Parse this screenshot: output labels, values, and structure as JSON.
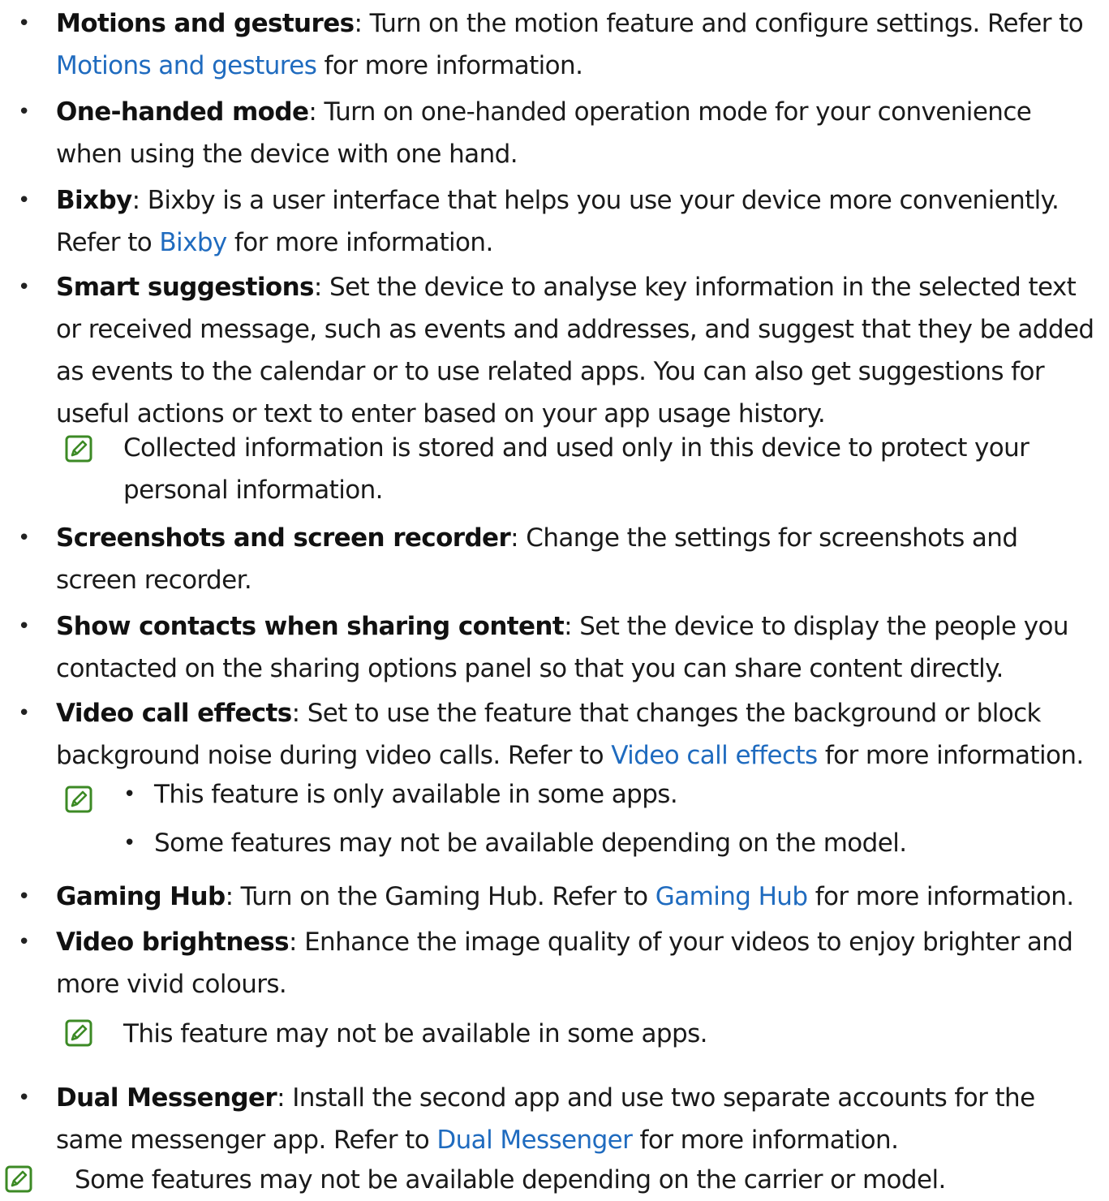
{
  "colors": {
    "text": "#1a1a1a",
    "link": "#1f6bbf",
    "note_icon": "#3c8a25"
  },
  "bullet_glyph": "•",
  "items": [
    {
      "term": "Motions and gestures",
      "before_link": ": Turn on the motion feature and configure settings. Refer to ",
      "link": "Motions and gestures",
      "after_link": " for more information."
    },
    {
      "term": "One-handed mode",
      "text": ": Turn on one-handed operation mode for your convenience when using the device with one hand."
    },
    {
      "term": "Bixby",
      "before_link": ": Bixby is a user interface that helps you use your device more conveniently. Refer to ",
      "link": "Bixby",
      "after_link": " for more information."
    },
    {
      "term": "Smart suggestions",
      "text": ": Set the device to analyse key information in the selected text or received message, such as events and addresses, and suggest that they be added as events to the calendar or to use related apps. You can also get suggestions for useful actions or text to enter based on your app usage history."
    },
    {
      "term": "Screenshots and screen recorder",
      "text": ": Change the settings for screenshots and screen recorder."
    },
    {
      "term": "Show contacts when sharing content",
      "text": ": Set the device to display the people you contacted on the sharing options panel so that you can share content directly."
    },
    {
      "term": "Video call effects",
      "before_link": ": Set to use the feature that changes the background or block background noise during video calls. Refer to ",
      "link": "Video call effects",
      "after_link": " for more information."
    },
    {
      "term": "Gaming Hub",
      "before_link": ": Turn on the Gaming Hub. Refer to ",
      "link": "Gaming Hub",
      "after_link": " for more information."
    },
    {
      "term": "Video brightness",
      "text": ": Enhance the image quality of your videos to enjoy brighter and more vivid colours."
    },
    {
      "term": "Dual Messenger",
      "before_link": ": Install the second app and use two separate accounts for the same messenger app. Refer to ",
      "link": "Dual Messenger",
      "after_link": " for more information."
    }
  ],
  "notes": {
    "smart_suggestions": "Collected information is stored and used only in this device to protect your personal information.",
    "video_call_effects": [
      "This feature is only available in some apps.",
      "Some features may not be available depending on the model."
    ],
    "video_brightness": "This feature may not be available in some apps.",
    "footer": "Some features may not be available depending on the carrier or model."
  },
  "icons": {
    "note": "note-pencil-icon"
  }
}
